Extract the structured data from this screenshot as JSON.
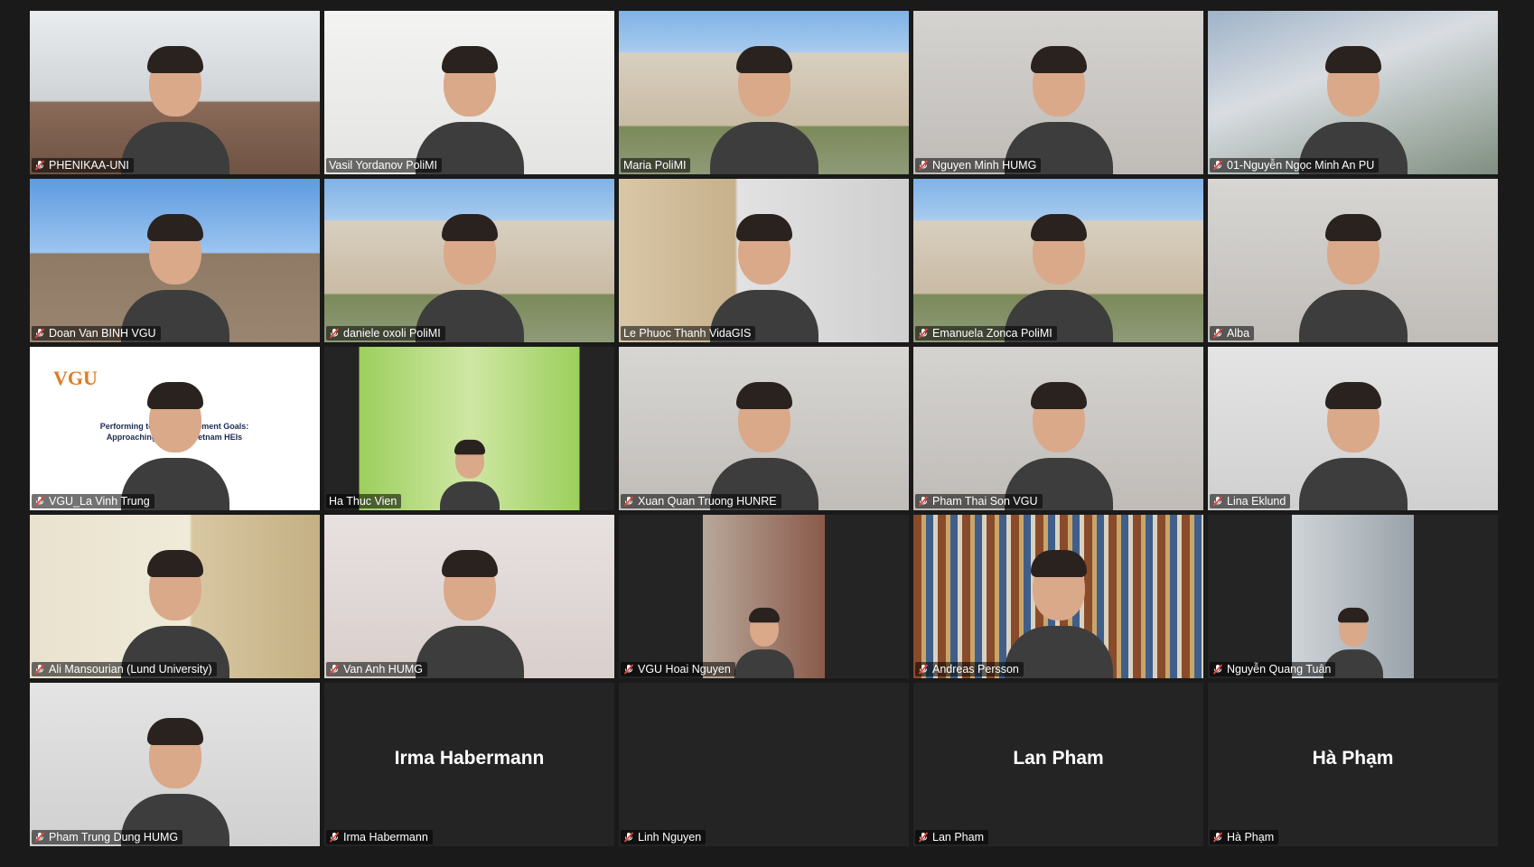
{
  "participants": [
    {
      "name": "PHENIKAA-UNI",
      "muted": true,
      "video": true,
      "bg": "bg-office",
      "active": false
    },
    {
      "name": "Vasil Yordanov PoliMI",
      "muted": false,
      "video": true,
      "bg": "bg-wall",
      "active": true
    },
    {
      "name": "Maria PoliMI",
      "muted": false,
      "video": true,
      "bg": "bg-palace",
      "active": false
    },
    {
      "name": "Nguyen Minh HUMG",
      "muted": true,
      "video": true,
      "bg": "bg-room",
      "active": false
    },
    {
      "name": "01-Nguyễn Ngọc Minh An PU",
      "muted": true,
      "video": true,
      "bg": "bg-render",
      "active": false
    },
    {
      "name": "Doan Van BINH VGU",
      "muted": true,
      "video": true,
      "bg": "bg-sea",
      "active": false
    },
    {
      "name": "daniele oxoli PoliMI",
      "muted": true,
      "video": true,
      "bg": "bg-palace",
      "active": false
    },
    {
      "name": "Le Phuoc Thanh VidaGIS",
      "muted": false,
      "video": true,
      "bg": "bg-shelf",
      "active": false
    },
    {
      "name": "Emanuela Zonca PoliMI",
      "muted": true,
      "video": true,
      "bg": "bg-palace",
      "active": false
    },
    {
      "name": "Alba",
      "muted": true,
      "video": true,
      "bg": "bg-blur",
      "active": false
    },
    {
      "name": "VGU_La Vinh Trung",
      "muted": true,
      "video": true,
      "bg": "bg-slide",
      "active": false
    },
    {
      "name": "Ha Thuc Vien",
      "muted": false,
      "video": true,
      "bg": "bg-grass",
      "active": false
    },
    {
      "name": "Xuan Quan Truong HUNRE",
      "muted": true,
      "video": true,
      "bg": "bg-blur",
      "active": false
    },
    {
      "name": "Pham Thai Son VGU",
      "muted": true,
      "video": true,
      "bg": "bg-room",
      "active": false
    },
    {
      "name": "Lina Eklund",
      "muted": true,
      "video": true,
      "bg": "bg-plain",
      "active": false
    },
    {
      "name": "Ali Mansourian (Lund University)",
      "muted": true,
      "video": true,
      "bg": "bg-door",
      "active": false
    },
    {
      "name": "Van Anh HUMG",
      "muted": true,
      "video": true,
      "bg": "bg-pink",
      "active": false
    },
    {
      "name": "VGU Hoai Nguyen",
      "muted": true,
      "video": true,
      "bg": "bg-bus",
      "active": false
    },
    {
      "name": "Andreas Persson",
      "muted": true,
      "video": true,
      "bg": "bg-books",
      "active": false
    },
    {
      "name": "Nguyễn Quang Tuân",
      "muted": true,
      "video": true,
      "bg": "bg-car",
      "active": false
    },
    {
      "name": "Pham Trung Dung HUMG",
      "muted": true,
      "video": true,
      "bg": "bg-plain",
      "active": false
    },
    {
      "name": "Irma Habermann",
      "muted": true,
      "video": false,
      "display_name": "Irma Habermann",
      "active": false
    },
    {
      "name": "Linh Nguyen",
      "muted": true,
      "video": false,
      "display_name": "",
      "active": false
    },
    {
      "name": "Lan Pham",
      "muted": true,
      "video": false,
      "display_name": "Lan Pham",
      "active": false
    },
    {
      "name": "Hà Phạm",
      "muted": true,
      "video": false,
      "display_name": "Hà Phạm",
      "active": false
    }
  ],
  "slide": {
    "logo": "VGU",
    "line1": "Performing tow… Development Goals:",
    "line2": "Approaching T… s in Vietnam HEIs"
  },
  "colors": {
    "active_outline": "#d7ef5a",
    "mute_red": "#e8453c",
    "tile_bg": "#242424",
    "page_bg": "#1a1a1a"
  },
  "icons": {
    "mute": "microphone-muted-icon"
  }
}
